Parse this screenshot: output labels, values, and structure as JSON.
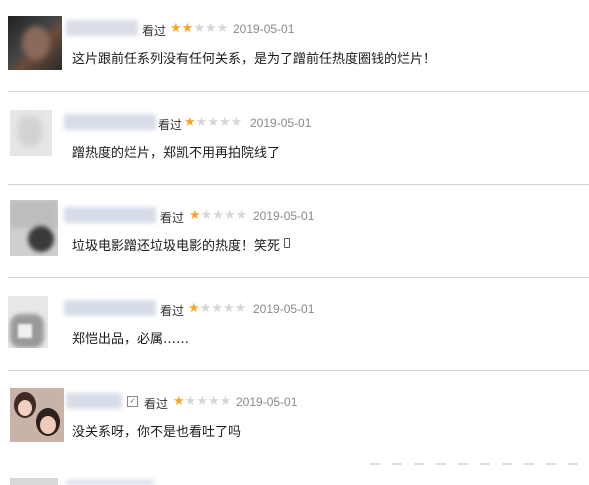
{
  "comments": [
    {
      "action": "看过",
      "stars": 2,
      "date": "2019-05-01",
      "text": "这片跟前任系列没有任何关系，是为了蹭前任热度圈钱的烂片！"
    },
    {
      "action": "看过",
      "stars": 1,
      "date": "2019-05-01",
      "text": "蹭热度的烂片，郑凯不用再拍院线了"
    },
    {
      "action": "看过",
      "stars": 1,
      "date": "2019-05-01",
      "text": "垃圾电影蹭还垃圾电影的热度！笑死"
    },
    {
      "action": "看过",
      "stars": 1,
      "date": "2019-05-01",
      "text": "郑恺出品，必属……"
    },
    {
      "action": "看过",
      "stars": 1,
      "date": "2019-05-01",
      "text": "没关系呀，你不是也看吐了吗"
    }
  ],
  "max_stars": 5,
  "colors": {
    "star_on": "#f5a623",
    "star_off": "#d6d6d6",
    "divider": "#d0d0d0"
  }
}
